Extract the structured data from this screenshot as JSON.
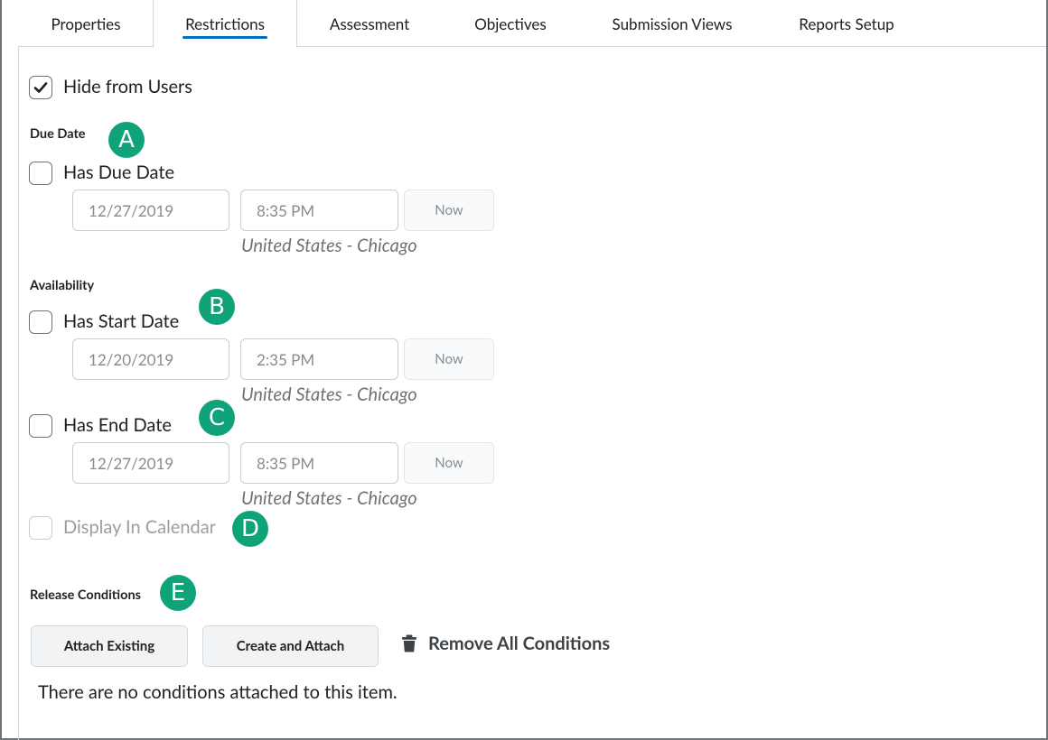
{
  "tabs": [
    {
      "label": "Properties",
      "active": false
    },
    {
      "label": "Restrictions",
      "active": true
    },
    {
      "label": "Assessment",
      "active": false
    },
    {
      "label": "Objectives",
      "active": false
    },
    {
      "label": "Submission Views",
      "active": false
    },
    {
      "label": "Reports Setup",
      "active": false
    }
  ],
  "hide_from_users": {
    "label": "Hide from Users",
    "checked": true
  },
  "due_date": {
    "heading": "Due Date",
    "badge": "A",
    "checkbox_label": "Has Due Date",
    "checked": false,
    "date_value": "12/27/2019",
    "time_value": "8:35 PM",
    "now_label": "Now",
    "timezone": "United States - Chicago"
  },
  "availability": {
    "heading": "Availability",
    "start": {
      "badge": "B",
      "checkbox_label": "Has Start Date",
      "checked": false,
      "date_value": "12/20/2019",
      "time_value": "2:35 PM",
      "now_label": "Now",
      "timezone": "United States - Chicago"
    },
    "end": {
      "badge": "C",
      "checkbox_label": "Has End Date",
      "checked": false,
      "date_value": "12/27/2019",
      "time_value": "8:35 PM",
      "now_label": "Now",
      "timezone": "United States - Chicago"
    },
    "calendar": {
      "badge": "D",
      "checkbox_label": "Display In Calendar",
      "checked": false,
      "disabled": true
    }
  },
  "release_conditions": {
    "heading": "Release Conditions",
    "badge": "E",
    "attach_existing_label": "Attach Existing",
    "create_attach_label": "Create and Attach",
    "remove_all_label": "Remove All Conditions",
    "empty_message": "There are no conditions attached to this item."
  },
  "colors": {
    "accent": "#006fbf",
    "badge": "#10a37a"
  },
  "icons": {
    "check": "checkmark-icon",
    "trash": "trash-icon"
  }
}
